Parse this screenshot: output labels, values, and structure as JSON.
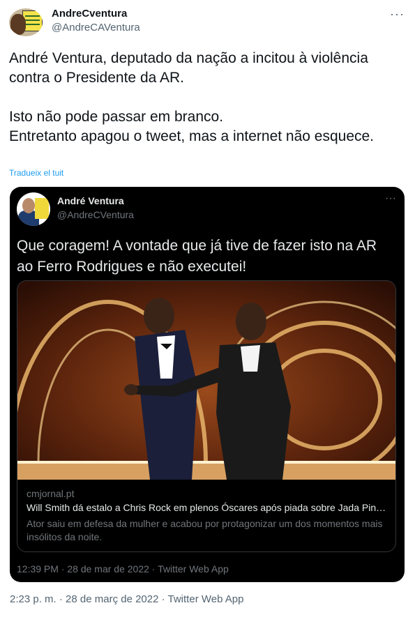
{
  "tweet": {
    "author_name": "AndreCventura",
    "author_handle": "@AndreCAVentura",
    "more_label": "···",
    "text": "André Ventura, deputado da nação a incitou à violência contra o Presidente da AR.\n\nIsto não pode passar em branco.\nEntretanto apagou o tweet, mas a internet não esquece.",
    "translate_label": "Tradueix el tuit",
    "timestamp": "2:23 p. m. · 28 de març de 2022 · Twitter Web App"
  },
  "quoted": {
    "author_name": "André Ventura",
    "author_handle": "@AndreCVentura",
    "more_label": "···",
    "text": "Que coragem! A vontade que já tive de fazer isto na AR\nao Ferro Rodrigues e não executei!",
    "card": {
      "domain": "cmjornal.pt",
      "title": "Will Smith dá estalo a Chris Rock em plenos Óscares após piada sobre Jada Pink…",
      "description": "Ator saiu em defesa da mulher e acabou por protagonizar um dos momentos mais insólitos da noite."
    },
    "timestamp": "12:39 PM · 28 de mar de 2022 · Twitter Web App"
  },
  "icons": {
    "outer_avatar": "avatar-image",
    "quoted_avatar": "avatar-image",
    "more": "more-options-icon"
  }
}
